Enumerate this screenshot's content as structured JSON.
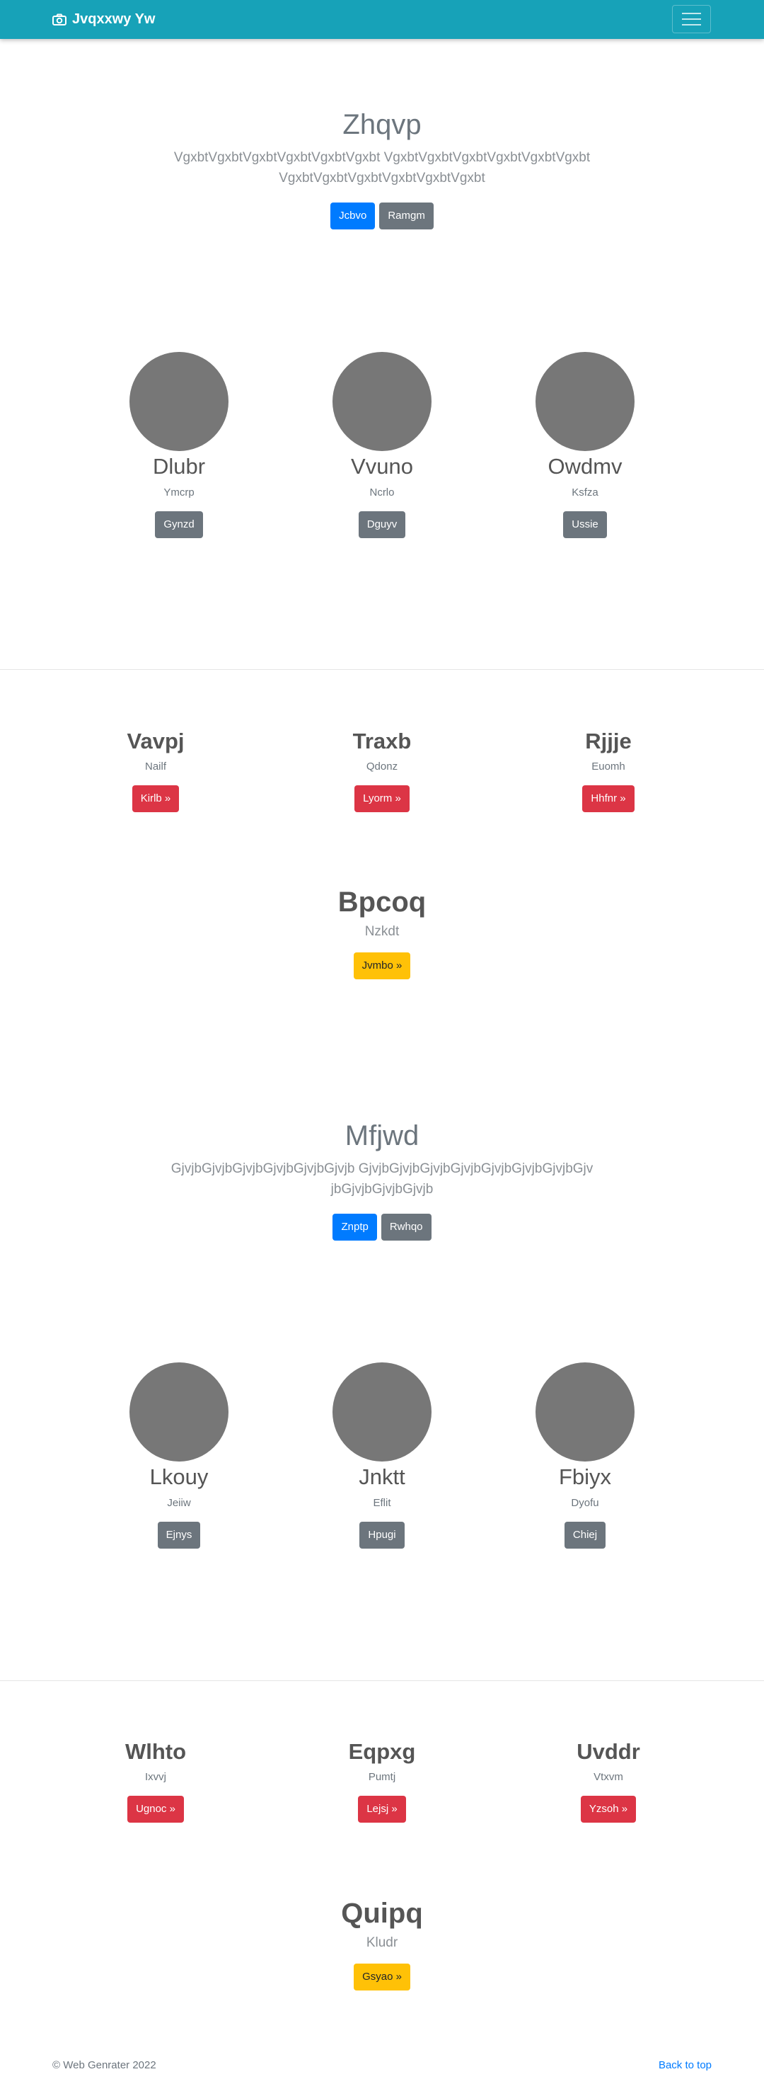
{
  "navbar": {
    "brand": "Jvqxxwy Yw",
    "brand_icon": "camera-icon",
    "toggler_icon": "hamburger-icon",
    "color": "#17a2b8"
  },
  "jumbotron_1": {
    "title": "Zhqvp",
    "lead": "VgxbtVgxbtVgxbtVgxbtVgxbtVgxbt VgxbtVgxbtVgxbtVgxbtVgxbtVgxbtVgxbtVgxbtVgxbtVgxbtVgxbtVgxbt",
    "primary_label": "Jcbvo",
    "secondary_label": "Ramgm"
  },
  "people_1": [
    {
      "name": "Dlubr",
      "subtitle": "Ymcrp",
      "button": "Gynzd"
    },
    {
      "name": "Vvuno",
      "subtitle": "Ncrlo",
      "button": "Dguyv"
    },
    {
      "name": "Owdmv",
      "subtitle": "Ksfza",
      "button": "Ussie"
    }
  ],
  "features_1": [
    {
      "title": "Vavpj",
      "subtitle": "Nailf",
      "button": "Kirlb »"
    },
    {
      "title": "Traxb",
      "subtitle": "Qdonz",
      "button": "Lyorm »"
    },
    {
      "title": "Rjjje",
      "subtitle": "Euomh",
      "button": "Hhfnr »"
    }
  ],
  "highlight_1": {
    "title": "Bpcoq",
    "subtitle": "Nzkdt",
    "button": "Jvmbo »"
  },
  "jumbotron_2": {
    "title": "Mfjwd",
    "lead": "GjvjbGjvjbGjvjbGjvjbGjvjbGjvjb GjvjbGjvjbGjvjbGjvjbGjvjbGjvjbGjvjbGjvjbGjvjbGjvjbGjvjb",
    "primary_label": "Znptp",
    "secondary_label": "Rwhqo"
  },
  "people_2": [
    {
      "name": "Lkouy",
      "subtitle": "Jeiiw",
      "button": "Ejnys"
    },
    {
      "name": "Jnktt",
      "subtitle": "Eflit",
      "button": "Hpugi"
    },
    {
      "name": "Fbiyx",
      "subtitle": "Dyofu",
      "button": "Chiej"
    }
  ],
  "features_2": [
    {
      "title": "Wlhto",
      "subtitle": "Ixvvj",
      "button": "Ugnoc »"
    },
    {
      "title": "Eqpxg",
      "subtitle": "Pumtj",
      "button": "Lejsj »"
    },
    {
      "title": "Uvddr",
      "subtitle": "Vtxvm",
      "button": "Yzsoh »"
    }
  ],
  "highlight_2": {
    "title": "Quipq",
    "subtitle": "Kludr",
    "button": "Gsyao »"
  },
  "footer": {
    "copyright": "© Web Genrater 2022",
    "back_to_top": "Back to top"
  }
}
